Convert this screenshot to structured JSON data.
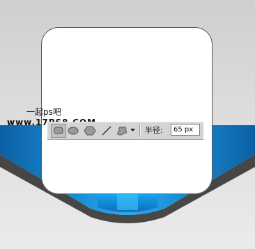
{
  "watermark": {
    "line1": "一起ps吧",
    "line2": "www.17PS8.COM"
  },
  "toolbar": {
    "tools": [
      {
        "name": "rounded-rectangle",
        "icon": "rounded-rect-icon",
        "selected": true
      },
      {
        "name": "ellipse",
        "icon": "ellipse-icon",
        "selected": false
      },
      {
        "name": "polygon",
        "icon": "polygon-icon",
        "selected": false
      },
      {
        "name": "line",
        "icon": "line-icon",
        "selected": false
      },
      {
        "name": "custom-shape",
        "icon": "custom-shape-icon",
        "selected": false
      }
    ],
    "radius_label": "半径:",
    "radius_value": "65 px"
  },
  "colors": {
    "background": "#d6d6d6",
    "ribbon_blue": "#1a8fd6",
    "ribbon_dark": "#0b5e9e",
    "ribbon_shadow": "#2a2a2a",
    "card": "#ffffff",
    "toolbar": "#d4d4d4"
  }
}
